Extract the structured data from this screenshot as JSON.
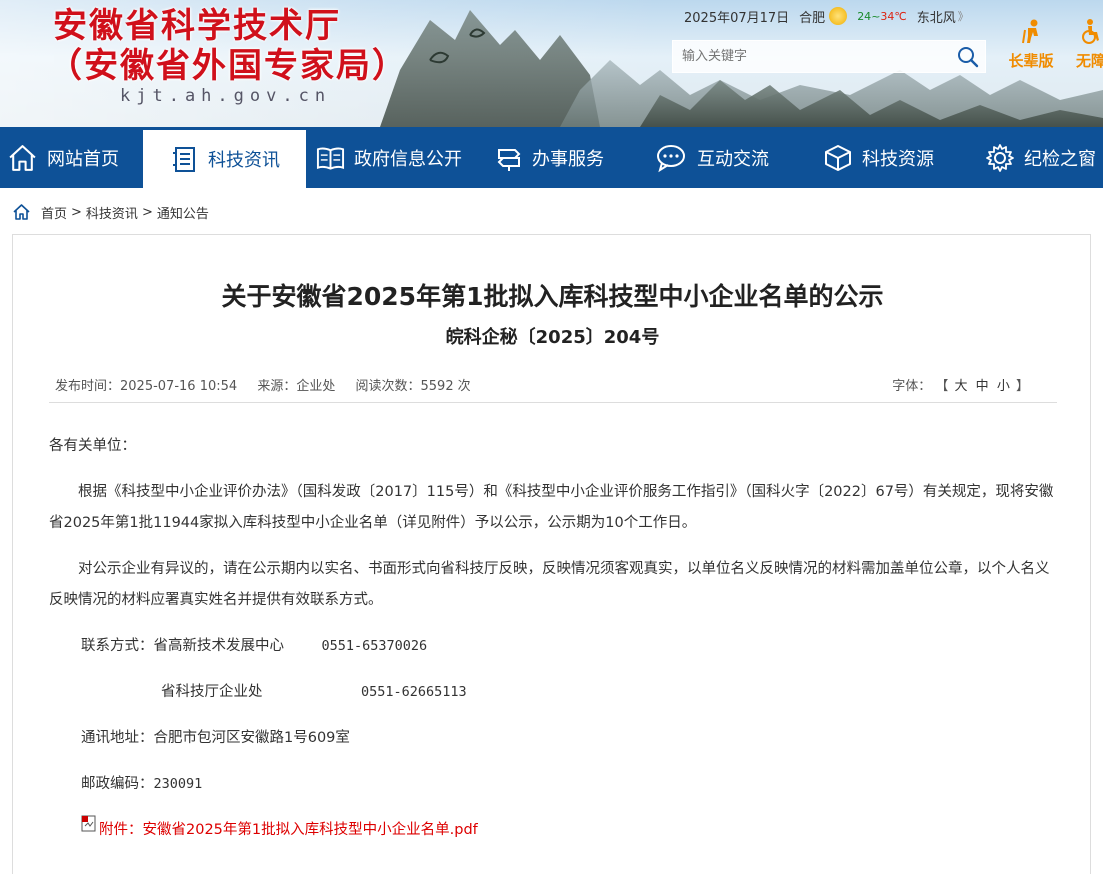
{
  "header": {
    "site_name_line1": "安徽省科学技术厅",
    "site_name_line2": "（安徽省外国专家局）",
    "domain": "kjt.ah.gov.cn",
    "date": "2025年07月17日",
    "city": "合肥",
    "temp_low": "24",
    "temp_sep": "~",
    "temp_high": "34",
    "temp_unit": "℃",
    "wind": "东北风",
    "wind_more": "》",
    "search_placeholder": "输入关键字",
    "tool_elder": "长辈版",
    "tool_accessible": "无障"
  },
  "nav": {
    "items": [
      {
        "label": "网站首页",
        "icon": "home-icon"
      },
      {
        "label": "科技资讯",
        "icon": "news-icon",
        "active": true
      },
      {
        "label": "政府信息公开",
        "icon": "book-icon"
      },
      {
        "label": "办事服务",
        "icon": "service-icon"
      },
      {
        "label": "互动交流",
        "icon": "chat-icon"
      },
      {
        "label": "科技资源",
        "icon": "cube-icon"
      },
      {
        "label": "纪检之窗",
        "icon": "gear-icon"
      }
    ]
  },
  "breadcrumb": {
    "home": "首页",
    "sep": ">",
    "level1": "科技资讯",
    "level2": "通知公告"
  },
  "article": {
    "title": "关于安徽省2025年第1批拟入库科技型中小企业名单的公示",
    "doc_number": "皖科企秘〔2025〕204号",
    "publish_label": "发布时间：",
    "publish_time": "2025-07-16 10:54",
    "source_label": "来源：",
    "source": "企业处",
    "views_label": "阅读次数：",
    "views": "5592",
    "views_unit": "次",
    "font_label": "字体：",
    "font_open": "【",
    "font_large": "大",
    "font_medium": "中",
    "font_small": "小",
    "font_close": "】",
    "salutation": "各有关单位：",
    "para1": "根据《科技型中小企业评价办法》（国科发政〔2017〕115号）和《科技型中小企业评价服务工作指引》（国科火字〔2022〕67号）有关规定，现将安徽省2025年第1批11944家拟入库科技型中小企业名单（详见附件）予以公示，公示期为10个工作日。",
    "para2": "对公示企业有异议的，请在公示期内以实名、书面形式向省科技厅反映，反映情况须客观真实，以单位名义反映情况的材料需加盖单位公章，以个人名义反映情况的材料应署真实姓名并提供有效联系方式。",
    "contact_label": "联系方式：",
    "contact1_org": "省高新技术发展中心",
    "contact1_phone": "0551-65370026",
    "contact2_org": "省科技厅企业处",
    "contact2_phone": "0551-62665113",
    "address_label": "通讯地址：",
    "address": "合肥市包河区安徽路1号609室",
    "postcode_label": "邮政编码：",
    "postcode": "230091",
    "attachment_label": "附件：",
    "attachment_file": "安徽省2025年第1批拟入库科技型中小企业名单.pdf"
  },
  "colors": {
    "nav_bg": "#0e5197",
    "site_name": "#d0101b",
    "accent_orange": "#f08c00",
    "attachment": "#dd0000"
  }
}
